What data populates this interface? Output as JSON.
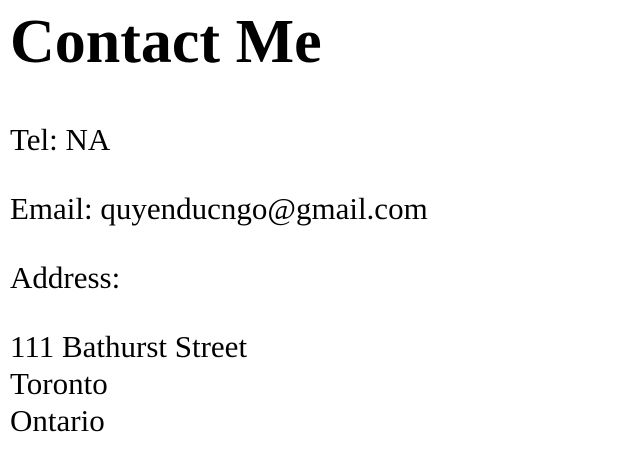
{
  "page": {
    "title": "Contact Me",
    "tel_label": "Tel: NA",
    "email_label": "Email: quyenducngo@gmail.com",
    "address_label": "Address:",
    "address_lines": [
      "111 Bathurst Street",
      "Toronto",
      "Ontario"
    ]
  }
}
